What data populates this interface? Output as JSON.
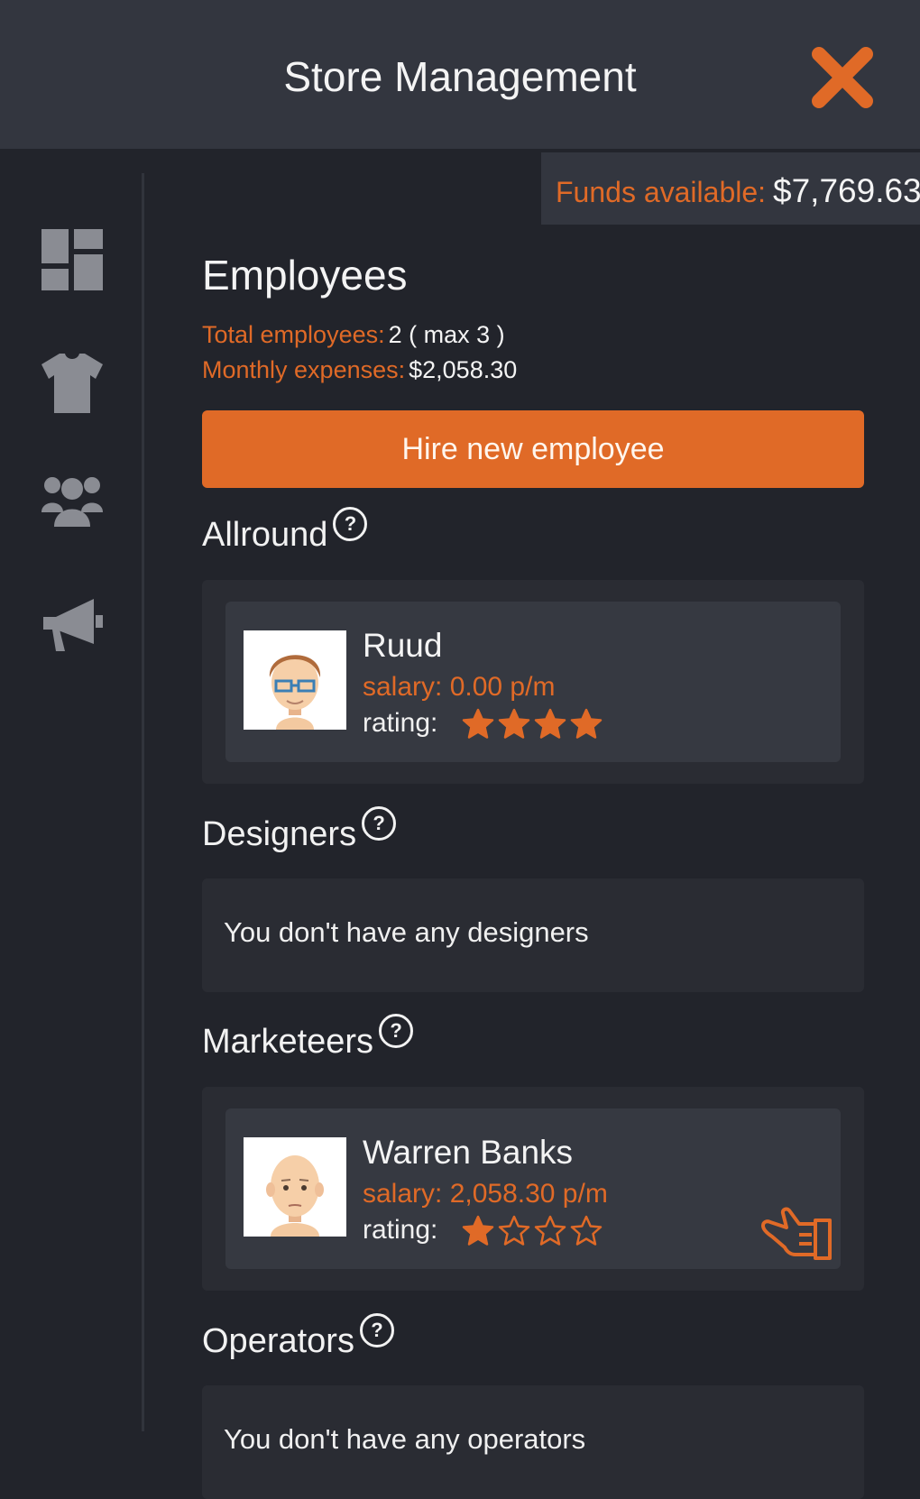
{
  "header": {
    "title": "Store Management",
    "close_icon": "close-icon"
  },
  "funds": {
    "label": "Funds available:",
    "value": "$7,769.63"
  },
  "sidebar": {
    "items": [
      {
        "icon": "dashboard-icon"
      },
      {
        "icon": "tshirt-icon"
      },
      {
        "icon": "employees-icon"
      },
      {
        "icon": "megaphone-icon"
      }
    ]
  },
  "page": {
    "title": "Employees",
    "total_label": "Total employees:",
    "total_value": "2 ( max 3 )",
    "expenses_label": "Monthly expenses:",
    "expenses_value": "$2,058.30",
    "hire_label": "Hire new employee"
  },
  "sections": {
    "allround": {
      "title": "Allround",
      "employee": {
        "name": "Ruud",
        "salary": "salary: 0.00 p/m",
        "rating_label": "rating:",
        "rating": 4,
        "max_rating": 4
      }
    },
    "designers": {
      "title": "Designers",
      "empty": "You don't have any designers"
    },
    "marketeers": {
      "title": "Marketeers",
      "employee": {
        "name": "Warren Banks",
        "salary": "salary: 2,058.30 p/m",
        "rating_label": "rating:",
        "rating": 1,
        "max_rating": 4
      }
    },
    "operators": {
      "title": "Operators",
      "empty": "You don't have any operators"
    }
  },
  "colors": {
    "accent": "#e06a27",
    "background": "#22242b",
    "panel": "#33363f",
    "icon": "#8a8c93"
  }
}
